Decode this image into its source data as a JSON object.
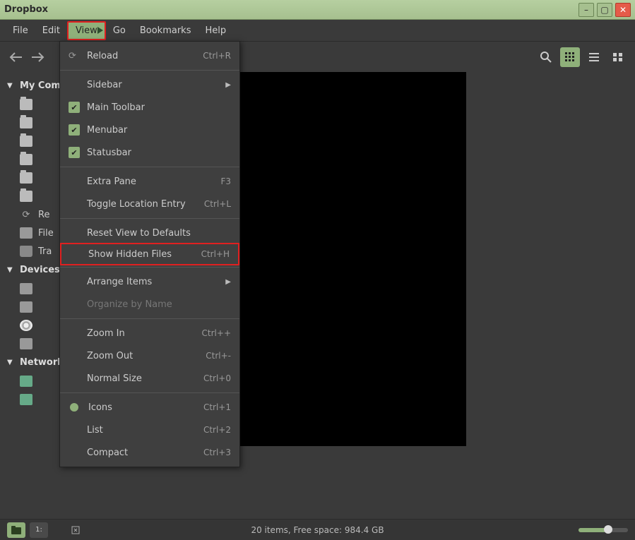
{
  "window": {
    "title": "Dropbox"
  },
  "menubar": [
    "File",
    "Edit",
    "View",
    "Go",
    "Bookmarks",
    "Help"
  ],
  "active_menu_index": 2,
  "view_menu": {
    "reload": {
      "label": "Reload",
      "accel": "Ctrl+R"
    },
    "sidebar": {
      "label": "Sidebar"
    },
    "main_toolbar": {
      "label": "Main Toolbar"
    },
    "menubar_item": {
      "label": "Menubar"
    },
    "statusbar": {
      "label": "Statusbar"
    },
    "extra_pane": {
      "label": "Extra Pane",
      "accel": "F3"
    },
    "toggle_location": {
      "label": "Toggle Location Entry",
      "accel": "Ctrl+L"
    },
    "reset_view": {
      "label": "Reset View to Defaults"
    },
    "show_hidden": {
      "label": "Show Hidden Files",
      "accel": "Ctrl+H"
    },
    "arrange": {
      "label": "Arrange Items"
    },
    "organize": {
      "label": "Organize by Name"
    },
    "zoom_in": {
      "label": "Zoom In",
      "accel": "Ctrl++"
    },
    "zoom_out": {
      "label": "Zoom Out",
      "accel": "Ctrl+-"
    },
    "normal_size": {
      "label": "Normal Size",
      "accel": "Ctrl+0"
    },
    "icons": {
      "label": "Icons",
      "accel": "Ctrl+1"
    },
    "list": {
      "label": "List",
      "accel": "Ctrl+2"
    },
    "compact": {
      "label": "Compact",
      "accel": "Ctrl+3"
    }
  },
  "sidebar": {
    "sections": [
      {
        "label": "My Computer",
        "key": "mycomputer"
      },
      {
        "label": "Devices",
        "key": "devices"
      },
      {
        "label": "Network",
        "key": "network"
      }
    ],
    "mycomputer_items": [
      {
        "label": ""
      },
      {
        "label": ""
      },
      {
        "label": ""
      },
      {
        "label": ""
      },
      {
        "label": ""
      },
      {
        "label": ""
      },
      {
        "label": "Re"
      },
      {
        "label": "File"
      },
      {
        "label": "Tra"
      }
    ],
    "network_items": [
      {
        "label": ""
      },
      {
        "label": ""
      }
    ]
  },
  "status": {
    "text": "20 items, Free space: 984.4 GB"
  },
  "path_current": "."
}
